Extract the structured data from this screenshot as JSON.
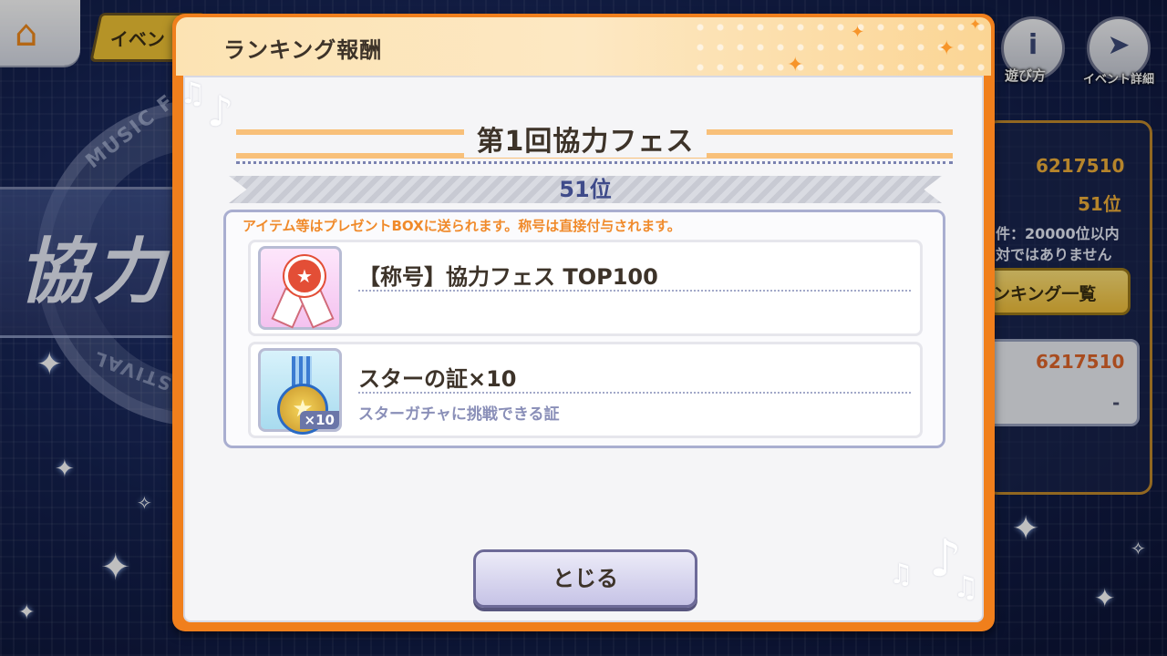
{
  "background": {
    "ring_text_top": "MUSIC F",
    "ring_text_bottom": "STIVAL",
    "big_title": "協力"
  },
  "header": {
    "home_icon": "home-icon",
    "event_tab_label": "イベン"
  },
  "right_menu": {
    "howto": {
      "glyph": "i",
      "label": "遊び方"
    },
    "event_detail": {
      "glyph": "➤",
      "label": "イベント詳細"
    }
  },
  "side_panel": {
    "score": "6217510",
    "rank": "51位",
    "condition_line1": "件：20000位以内",
    "condition_line2": "対ではありません",
    "ranking_list_button": "ンキング一覧",
    "box_score": "6217510",
    "box_dash": "-"
  },
  "modal": {
    "title": "ランキング報酬",
    "event_name": "第1回協力フェス",
    "rank": "51位",
    "notice": "アイテム等はプレゼントBOXに送られます。称号は直接付与されます。",
    "rewards": [
      {
        "icon": "title-badge-icon",
        "name": "【称号】協力フェス TOP100",
        "description": "",
        "quantity": ""
      },
      {
        "icon": "star-medal-icon",
        "name": "スターの証×10",
        "description": "スターガチャに挑戦できる証",
        "quantity": "×10"
      }
    ],
    "close_label": "とじる"
  },
  "colors": {
    "modal_border": "#f07f1c",
    "rank_text": "#3f4b8a",
    "notice_text": "#f08a2a",
    "score_text": "#f2b13a"
  }
}
